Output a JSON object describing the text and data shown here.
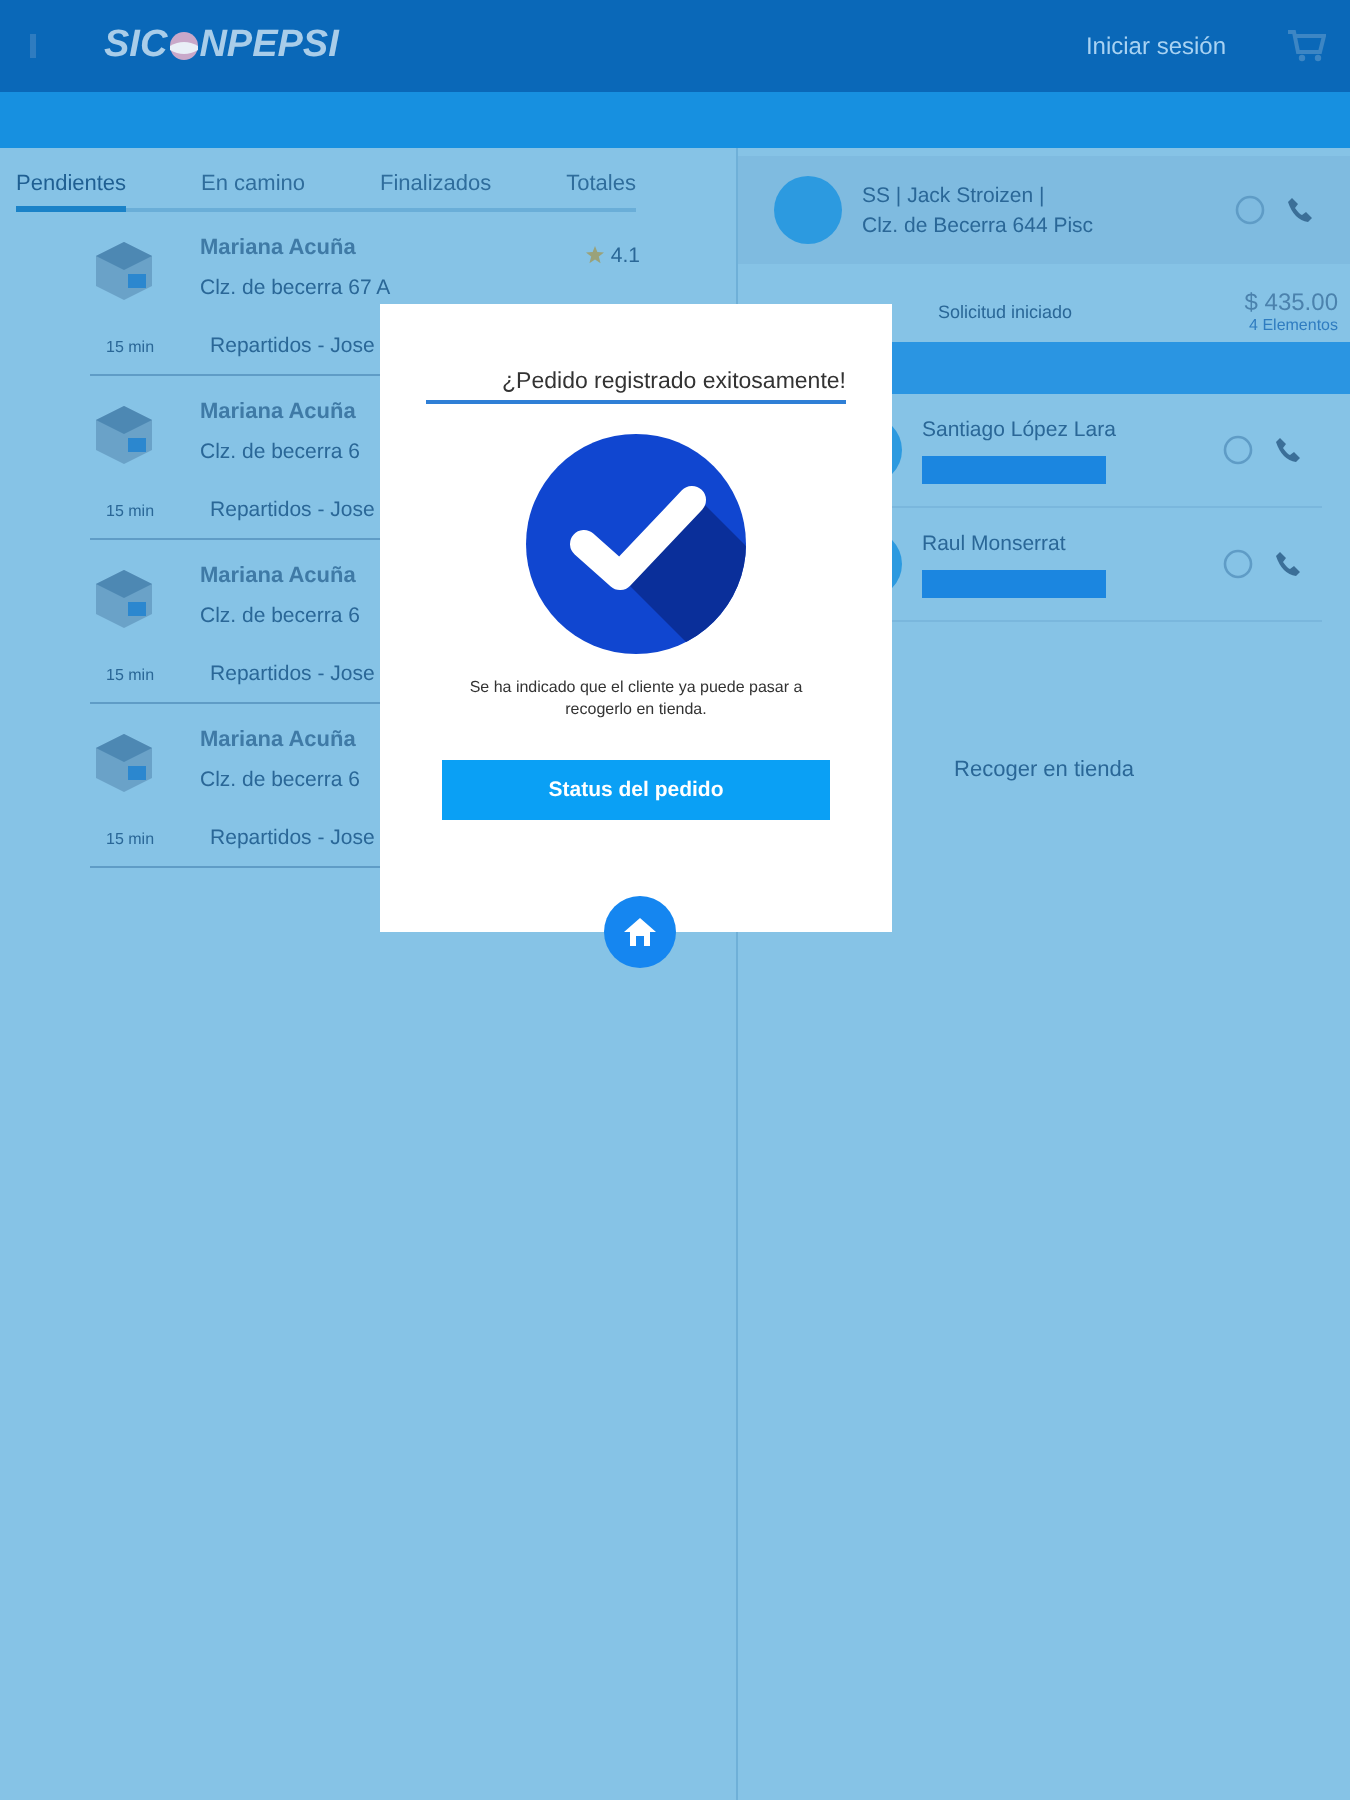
{
  "header": {
    "logo_start": "SIC",
    "logo_end": "NPEPSI",
    "login": "Iniciar sesión"
  },
  "tabs": [
    {
      "label": "Pendientes",
      "selected": true
    },
    {
      "label": "En camino",
      "selected": false
    },
    {
      "label": "Finalizados",
      "selected": false
    },
    {
      "label": "Totales",
      "selected": false
    }
  ],
  "orders": [
    {
      "name": "Mariana Acuña",
      "address": "Clz. de becerra 67 A",
      "rating": "4.1",
      "time": "15 min",
      "courier": "Repartidos - Jose"
    },
    {
      "name": "Mariana Acuña",
      "address": "Clz. de becerra 6",
      "time": "15 min",
      "courier": "Repartidos - Jose"
    },
    {
      "name": "Mariana Acuña",
      "address": "Clz. de becerra 6",
      "time": "15 min",
      "courier": "Repartidos - Jose"
    },
    {
      "name": "Mariana Acuña",
      "address": "Clz. de becerra 6",
      "time": "15 min",
      "courier": "Repartidos - Jose"
    }
  ],
  "store": {
    "name": "SS | Jack Stroizen |",
    "address": "Clz. de Becerra 644 Pisc"
  },
  "summary": {
    "status": "Solicitud iniciado",
    "total": "$ 435.00",
    "items": "4 Elementos"
  },
  "couriers": [
    {
      "name": "Santiago López Lara"
    },
    {
      "name": "Raul Monserrat"
    }
  ],
  "pickup": "Recoger en tienda",
  "modal": {
    "title": "¿Pedido registrado exitosamente!",
    "message": "Se ha indicado que el cliente ya puede pasar a recogerlo en tienda.",
    "button": "Status del pedido"
  }
}
